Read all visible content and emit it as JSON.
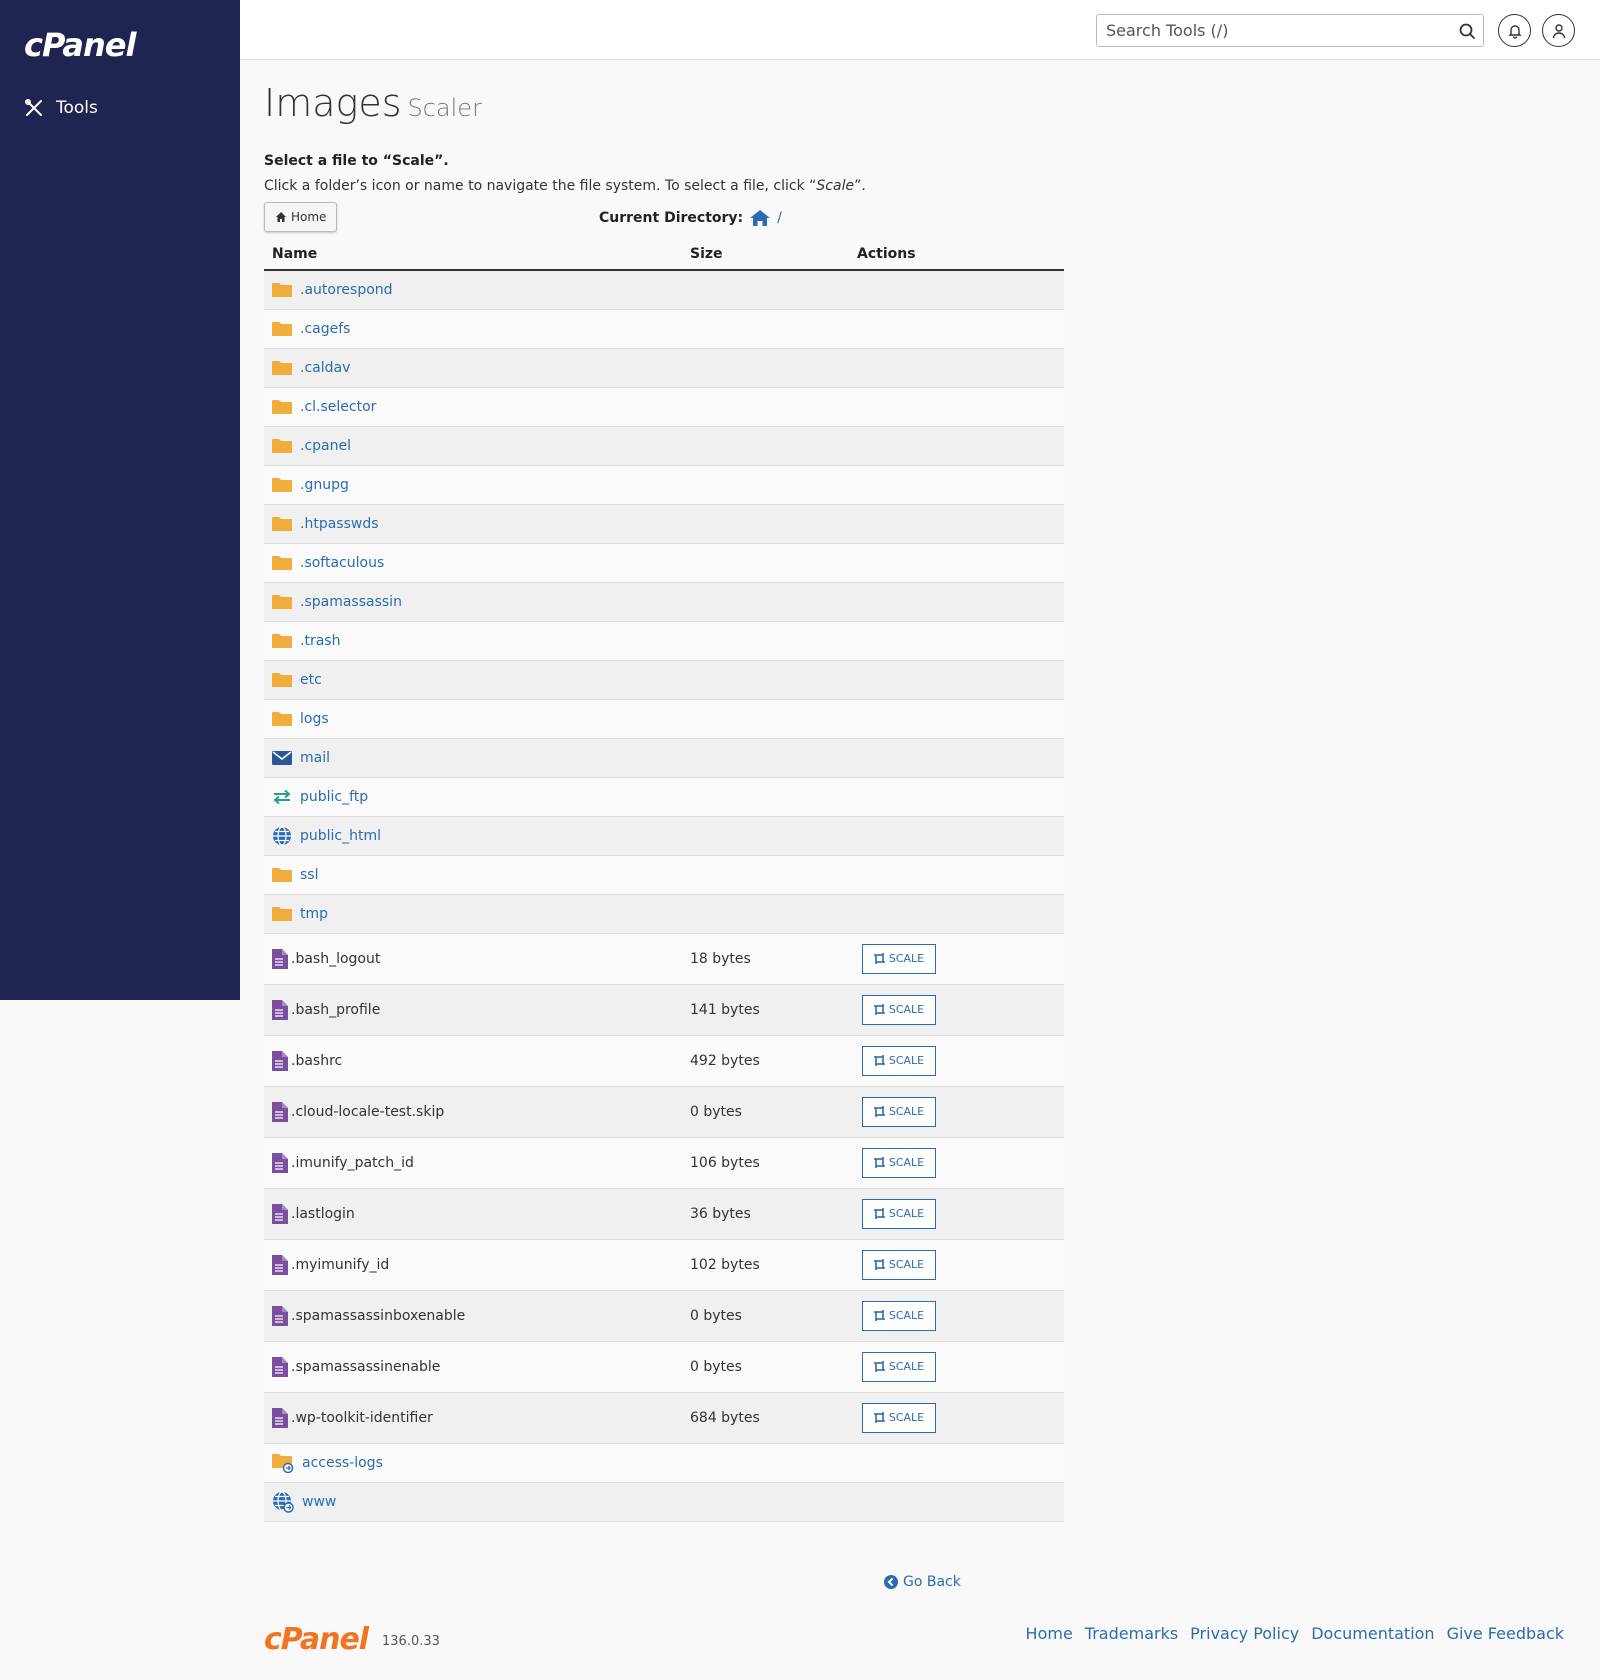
{
  "sidebar": {
    "logo": "cPanel",
    "tools_label": "Tools"
  },
  "topbar": {
    "search_placeholder": "Search Tools (/)"
  },
  "page": {
    "title": "Images",
    "subtitle": "Scaler",
    "instruction_bold": "Select a file to “Scale”.",
    "instruction_prefix": "Click a folder’s icon or name to navigate the file system. To select a file, click “",
    "instruction_em": "Scale",
    "instruction_suffix": "”."
  },
  "nav": {
    "home_button": "Home",
    "current_dir_label": "Current Directory:",
    "current_dir_path": "/"
  },
  "table": {
    "headers": [
      "Name",
      "Size",
      "Actions"
    ],
    "scale_label": "SCALE",
    "rows": [
      {
        "name": ".autorespond",
        "icon": "folder-icon",
        "type": "dir"
      },
      {
        "name": ".cagefs",
        "icon": "folder-icon",
        "type": "dir"
      },
      {
        "name": ".caldav",
        "icon": "folder-icon",
        "type": "dir"
      },
      {
        "name": ".cl.selector",
        "icon": "folder-icon",
        "type": "dir"
      },
      {
        "name": ".cpanel",
        "icon": "folder-icon",
        "type": "dir"
      },
      {
        "name": ".gnupg",
        "icon": "folder-icon",
        "type": "dir"
      },
      {
        "name": ".htpasswds",
        "icon": "folder-icon",
        "type": "dir"
      },
      {
        "name": ".softaculous",
        "icon": "folder-icon",
        "type": "dir"
      },
      {
        "name": ".spamassassin",
        "icon": "folder-icon",
        "type": "dir"
      },
      {
        "name": ".trash",
        "icon": "folder-icon",
        "type": "dir"
      },
      {
        "name": "etc",
        "icon": "folder-icon",
        "type": "dir"
      },
      {
        "name": "logs",
        "icon": "folder-icon",
        "type": "dir"
      },
      {
        "name": "mail",
        "icon": "envelope-icon",
        "type": "dir"
      },
      {
        "name": "public_ftp",
        "icon": "transfer-arrows-icon",
        "type": "dir"
      },
      {
        "name": "public_html",
        "icon": "globe-icon",
        "type": "dir"
      },
      {
        "name": "ssl",
        "icon": "folder-icon",
        "type": "dir"
      },
      {
        "name": "tmp",
        "icon": "folder-icon",
        "type": "dir"
      },
      {
        "name": ".bash_logout",
        "size": "18 bytes",
        "icon": "file-icon",
        "type": "file"
      },
      {
        "name": ".bash_profile",
        "size": "141 bytes",
        "icon": "file-icon",
        "type": "file"
      },
      {
        "name": ".bashrc",
        "size": "492 bytes",
        "icon": "file-icon",
        "type": "file"
      },
      {
        "name": ".cloud-locale-test.skip",
        "size": "0 bytes",
        "icon": "file-icon",
        "type": "file"
      },
      {
        "name": ".imunify_patch_id",
        "size": "106 bytes",
        "icon": "file-icon",
        "type": "file"
      },
      {
        "name": ".lastlogin",
        "size": "36 bytes",
        "icon": "file-icon",
        "type": "file"
      },
      {
        "name": ".myimunify_id",
        "size": "102 bytes",
        "icon": "file-icon",
        "type": "file"
      },
      {
        "name": ".spamassassinboxenable",
        "size": "0 bytes",
        "icon": "file-icon",
        "type": "file"
      },
      {
        "name": ".spamassassinenable",
        "size": "0 bytes",
        "icon": "file-icon",
        "type": "file"
      },
      {
        "name": ".wp-toolkit-identifier",
        "size": "684 bytes",
        "icon": "file-icon",
        "type": "file"
      },
      {
        "name": "access-logs",
        "icon": "folder-link-icon",
        "type": "dir"
      },
      {
        "name": "www",
        "icon": "globe-link-icon",
        "type": "dir"
      }
    ]
  },
  "go_back": "Go Back",
  "footer": {
    "logo": "cPanel",
    "version": "136.0.33",
    "links": [
      "Home",
      "Trademarks",
      "Privacy Policy",
      "Documentation",
      "Give Feedback"
    ]
  },
  "colors": {
    "sidebar_bg": "#1f2450",
    "link": "#2b6cb0",
    "folder": "#f0ad3c",
    "file": "#7b4f9d",
    "ftp": "#2a9d8f",
    "brand_orange": "#f47321"
  }
}
